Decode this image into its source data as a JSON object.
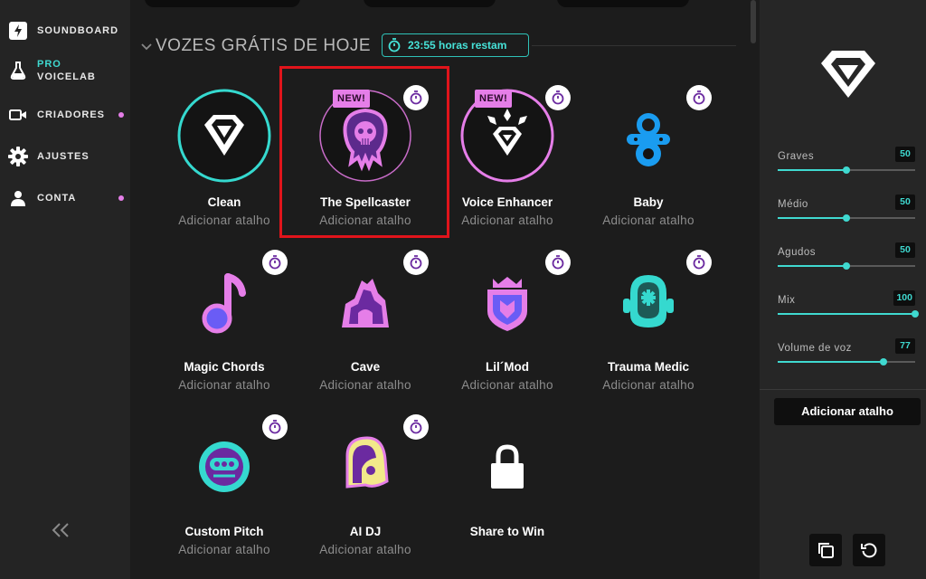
{
  "sidebar": {
    "items": [
      {
        "label": "SOUNDBOARD",
        "icon": "lightning-icon"
      },
      {
        "pro": "PRO",
        "label": "VOICELAB",
        "icon": "flask-icon"
      },
      {
        "label": "CRIADORES",
        "icon": "video-camera-icon",
        "dot": true
      },
      {
        "label": "AJUSTES",
        "icon": "gear-icon"
      },
      {
        "label": "CONTA",
        "icon": "user-icon",
        "dot": true
      }
    ],
    "collapse_icon": "double-chevron-left-icon"
  },
  "main": {
    "section_title": "VOZES GRÁTIS DE HOJE",
    "timer": "23:55 horas restam",
    "cards": [
      {
        "name": "Clean",
        "sub": "Adicionar atalho",
        "icon": "clean-diamond-icon",
        "timer": false,
        "new": false
      },
      {
        "name": "The Spellcaster",
        "sub": "Adicionar atalho",
        "icon": "spellcaster-skull-icon",
        "timer": true,
        "new": true
      },
      {
        "name": "Voice Enhancer",
        "sub": "Adicionar atalho",
        "icon": "voice-enhancer-icon",
        "timer": true,
        "new": true
      },
      {
        "name": "Baby",
        "sub": "Adicionar atalho",
        "icon": "pacifier-icon",
        "timer": true,
        "new": false
      },
      {
        "name": "Magic Chords",
        "sub": "Adicionar atalho",
        "icon": "music-note-icon",
        "timer": true,
        "new": false
      },
      {
        "name": "Cave",
        "sub": "Adicionar atalho",
        "icon": "cave-icon",
        "timer": true,
        "new": false
      },
      {
        "name": "Lil´Mod",
        "sub": "Adicionar atalho",
        "icon": "crown-shield-icon",
        "timer": true,
        "new": false
      },
      {
        "name": "Trauma Medic",
        "sub": "Adicionar atalho",
        "icon": "medic-helmet-icon",
        "timer": true,
        "new": false
      },
      {
        "name": "Custom Pitch",
        "sub": "Adicionar atalho",
        "icon": "robot-face-icon",
        "timer": true,
        "new": false
      },
      {
        "name": "AI DJ",
        "sub": "Adicionar atalho",
        "icon": "dj-helmet-icon",
        "timer": true,
        "new": false
      },
      {
        "name": "Share to Win",
        "sub": "",
        "icon": "lock-icon",
        "timer": false,
        "new": false
      }
    ],
    "new_badge": "NEW!"
  },
  "panel": {
    "sliders": [
      {
        "label": "Graves",
        "value": "50",
        "fraction": 0.5
      },
      {
        "label": "Médio",
        "value": "50",
        "fraction": 0.5
      },
      {
        "label": "Agudos",
        "value": "50",
        "fraction": 0.5
      },
      {
        "label": "Mix",
        "value": "100",
        "fraction": 1.0
      },
      {
        "label": "Volume de voz",
        "value": "77",
        "fraction": 0.77
      }
    ],
    "add_shortcut": "Adicionar atalho",
    "copy_icon": "copy-icon",
    "reset_icon": "reset-icon"
  },
  "colors": {
    "accent": "#3fd9d0",
    "pink": "#e57ee8",
    "highlight": "#e0141b"
  }
}
